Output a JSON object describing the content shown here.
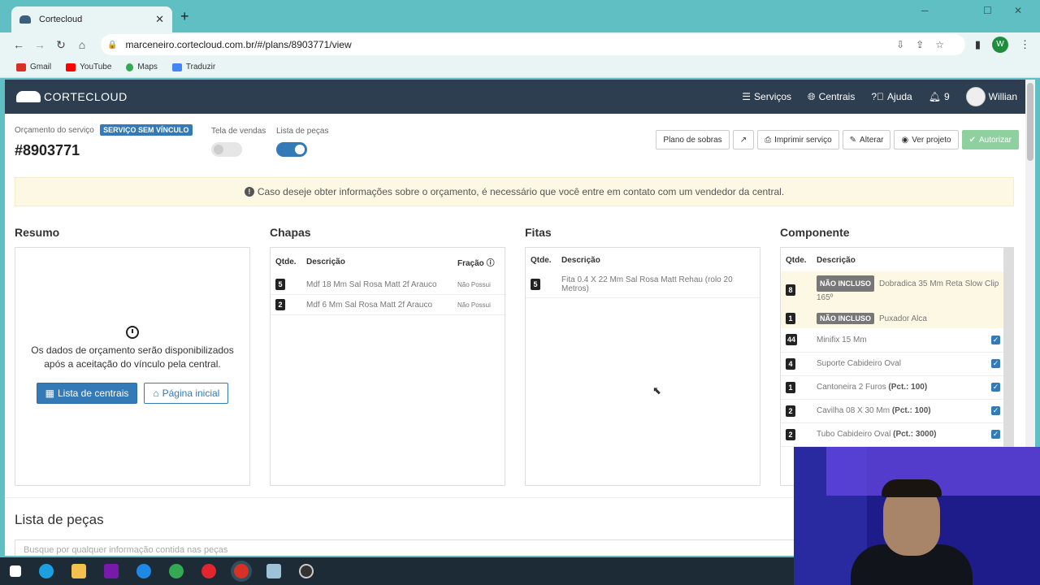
{
  "browser": {
    "tab_title": "Cortecloud",
    "url": "marceneiro.cortecloud.com.br/#/plans/8903771/view",
    "profile_initial": "W",
    "bookmarks": [
      {
        "label": "Gmail",
        "color": "#d93025"
      },
      {
        "label": "YouTube",
        "color": "#ff0000"
      },
      {
        "label": "Maps",
        "color": "#34a853"
      },
      {
        "label": "Traduzir",
        "color": "#4285f4"
      }
    ]
  },
  "nav": {
    "logo_text": "CORTECLOUD",
    "servicos": "Serviços",
    "centrais": "Centrais",
    "ajuda": "Ajuda",
    "notifications": "9",
    "user": "Willian"
  },
  "header": {
    "label": "Orçamento do serviço",
    "badge": "SERVIÇO SEM VÍNCULO",
    "order_number": "#8903771",
    "toggle_vendas_label": "Tela de vendas",
    "toggle_vendas_on": false,
    "toggle_pecas_label": "Lista de peças",
    "toggle_pecas_on": true
  },
  "actions": {
    "plano_sobras": "Plano de sobras",
    "imprimir": "Imprimir serviço",
    "alterar": "Alterar",
    "ver_projeto": "Ver projeto",
    "autorizar": "Autorizar"
  },
  "alert": {
    "text": "Caso deseje obter informações sobre o orçamento, é necessário que você entre em contato com um vendedor da central."
  },
  "resumo": {
    "title": "Resumo",
    "message_line1": "Os dados de orçamento serão disponibilizados",
    "message_line2": "após a aceitação do vínculo pela central.",
    "btn_centrais": "Lista de centrais",
    "btn_inicial": "Página inicial"
  },
  "chapas": {
    "title": "Chapas",
    "headers": {
      "qtde": "Qtde.",
      "descricao": "Descrição",
      "fracao": "Fração"
    },
    "rows": [
      {
        "qtde": "5",
        "descricao": "Mdf 18 Mm Sal Rosa Matt 2f Arauco",
        "fracao": "Não Possui"
      },
      {
        "qtde": "2",
        "descricao": "Mdf 6 Mm Sal Rosa Matt 2f Arauco",
        "fracao": "Não Possui"
      }
    ]
  },
  "fitas": {
    "title": "Fitas",
    "headers": {
      "qtde": "Qtde.",
      "descricao": "Descrição"
    },
    "rows": [
      {
        "qtde": "5",
        "descricao": "Fita 0.4 X 22 Mm Sal Rosa Matt Rehau (rolo 20 Metros)"
      }
    ]
  },
  "componente": {
    "title": "Componente",
    "headers": {
      "qtde": "Qtde.",
      "descricao": "Descrição"
    },
    "nao_incluso_label": "NÃO INCLUSO",
    "rows": [
      {
        "qtde": "8",
        "descricao": "Dobradica 35 Mm Reta Slow Clip 165º",
        "pct": "",
        "nao_incluso": true
      },
      {
        "qtde": "1",
        "descricao": "Puxador Alca",
        "pct": "",
        "nao_incluso": true
      },
      {
        "qtde": "44",
        "descricao": "Minifix 15 Mm",
        "pct": "",
        "nao_incluso": false
      },
      {
        "qtde": "4",
        "descricao": "Suporte Cabideiro Oval",
        "pct": "",
        "nao_incluso": false
      },
      {
        "qtde": "1",
        "descricao": "Cantoneira 2 Furos",
        "pct": "(Pct.: 100)",
        "nao_incluso": false
      },
      {
        "qtde": "2",
        "descricao": "Cavilha 08 X 30 Mm",
        "pct": "(Pct.: 100)",
        "nao_incluso": false
      },
      {
        "qtde": "2",
        "descricao": "Tubo Cabideiro Oval",
        "pct": "(Pct.: 3000)",
        "nao_incluso": false
      }
    ]
  },
  "lista_pecas": {
    "title": "Lista de peças",
    "search_placeholder": "Busque por qualquer informação contida nas peças"
  }
}
